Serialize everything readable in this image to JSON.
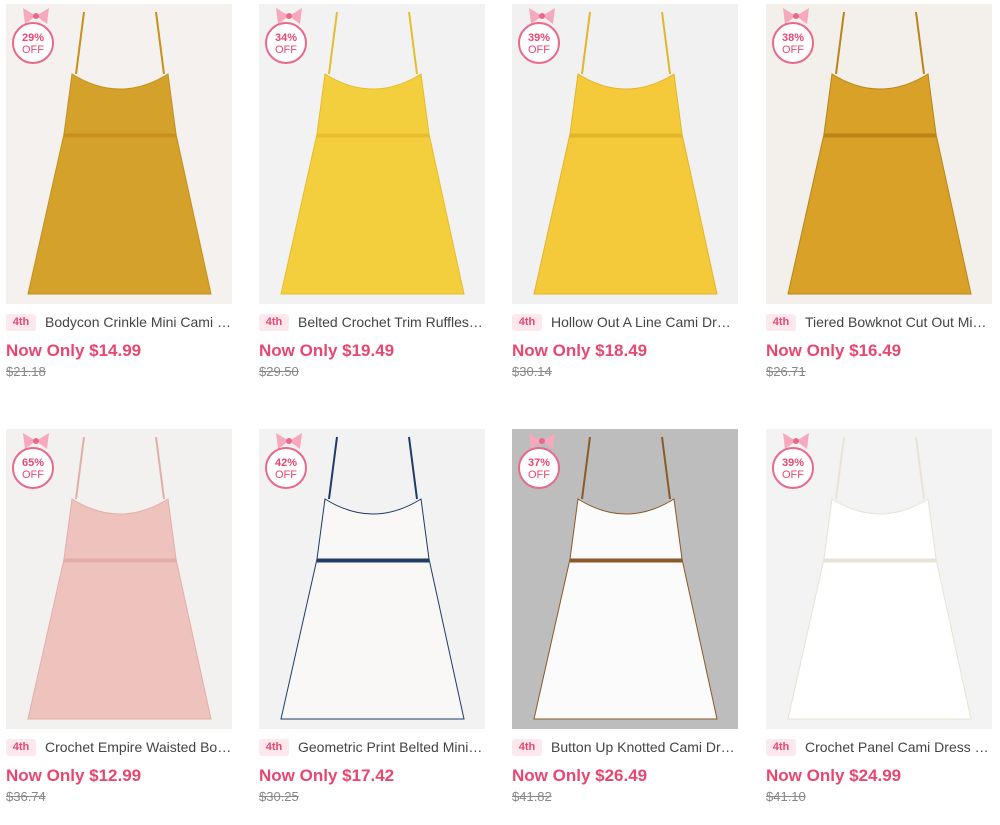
{
  "products": [
    {
      "discount": "29%",
      "off": "OFF",
      "tag": "4th",
      "title": "Bodycon Crinkle Mini Cami Dress",
      "price": "Now Only $14.99",
      "old_price": "$21.18",
      "colors": {
        "bg": "#f4f1ee",
        "dress": "#d4a12a",
        "accent": "#c78f1c"
      }
    },
    {
      "discount": "34%",
      "off": "OFF",
      "tag": "4th",
      "title": "Belted Crochet Trim Ruffles Dress",
      "price": "Now Only $19.49",
      "old_price": "$29.50",
      "colors": {
        "bg": "#f2f2f2",
        "dress": "#f3cf3e",
        "accent": "#e6bd2c"
      }
    },
    {
      "discount": "39%",
      "off": "OFF",
      "tag": "4th",
      "title": "Hollow Out A Line Cami Dress",
      "price": "Now Only $18.49",
      "old_price": "$30.14",
      "colors": {
        "bg": "#f1f1f1",
        "dress": "#f4c93a",
        "accent": "#e3b52a"
      }
    },
    {
      "discount": "38%",
      "off": "OFF",
      "tag": "4th",
      "title": "Tiered Bowknot Cut Out Mini Dress",
      "price": "Now Only $16.49",
      "old_price": "$26.71",
      "colors": {
        "bg": "#f3f0ec",
        "dress": "#d9a127",
        "accent": "#bb8418"
      }
    },
    {
      "discount": "65%",
      "off": "OFF",
      "tag": "4th",
      "title": "Crochet Empire Waisted Boho Dress",
      "price": "Now Only $12.99",
      "old_price": "$36.74",
      "colors": {
        "bg": "#f3f1ef",
        "dress": "#efc3bd",
        "accent": "#e3aea8"
      }
    },
    {
      "discount": "42%",
      "off": "OFF",
      "tag": "4th",
      "title": "Geometric Print Belted Mini Dress",
      "price": "Now Only $17.42",
      "old_price": "$30.25",
      "colors": {
        "bg": "#f2f2f2",
        "dress": "#faf8f6",
        "accent": "#1f3b66"
      }
    },
    {
      "discount": "37%",
      "off": "OFF",
      "tag": "4th",
      "title": "Button Up Knotted Cami Dress",
      "price": "Now Only $26.49",
      "old_price": "$41.82",
      "colors": {
        "bg": "#bdbdbd",
        "dress": "#fbfbfb",
        "accent": "#8a5a2a"
      }
    },
    {
      "discount": "39%",
      "off": "OFF",
      "tag": "4th",
      "title": "Crochet Panel Cami Dress - White",
      "price": "Now Only $24.99",
      "old_price": "$41.10",
      "colors": {
        "bg": "#f3f3f3",
        "dress": "#ffffff",
        "accent": "#e9e2d6"
      }
    }
  ]
}
